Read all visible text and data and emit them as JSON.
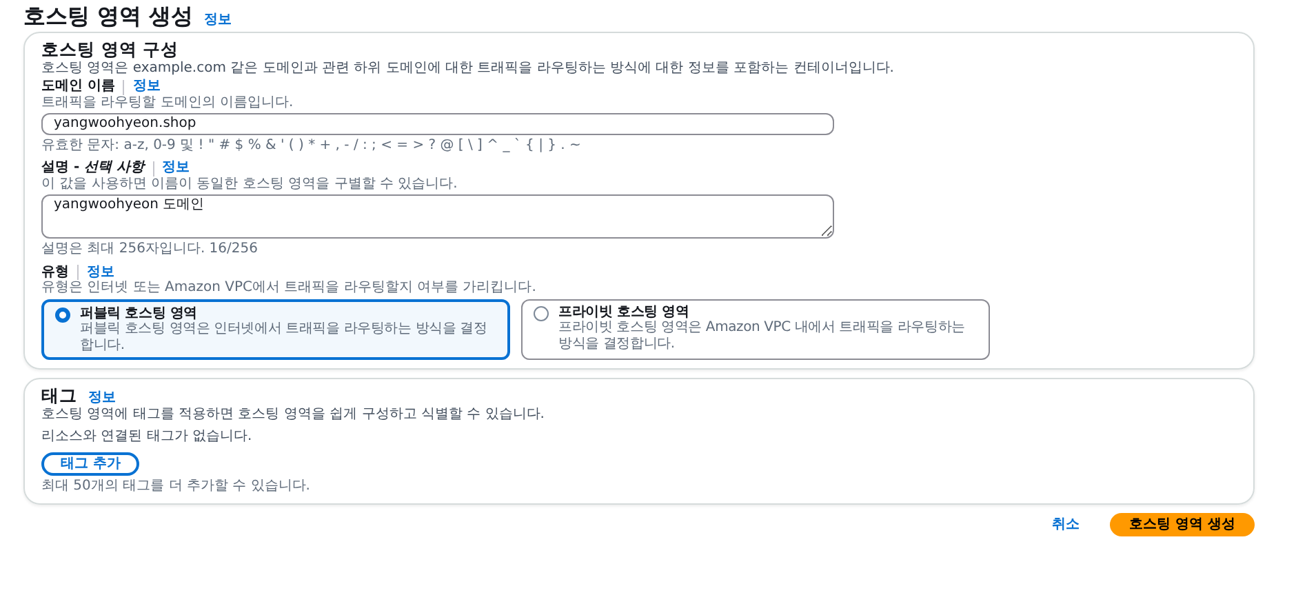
{
  "page": {
    "title": "호스팅 영역 생성",
    "info": "정보"
  },
  "config": {
    "heading": "호스팅 영역 구성",
    "description": "호스팅 영역은 example.com 같은 도메인과 관련 하위 도메인에 대한 트래픽을 라우팅하는 방식에 대한 정보를 포함하는 컨테이너입니다.",
    "fields": [
      {
        "kind": "input",
        "label": "도메인 이름",
        "info": "정보",
        "hint": "트래픽을 라우팅할 도메인의 이름입니다.",
        "value": "yangwoohyeon.shop",
        "note": "유효한 문자: a-z, 0-9 및 ! \" # $ % & ' ( ) * + , - / : ; < = > ? @ [ \\ ] ^ _ ` { | } . ~"
      },
      {
        "kind": "textarea",
        "label": "설명 - *선택 사항*",
        "info": "정보",
        "hint": "이 값을 사용하면 이름이 동일한 호스팅 영역을 구별할 수 있습니다.",
        "value": "yangwoohyeon 도메인",
        "note": "설명은 최대 256자입니다. 16/256"
      },
      {
        "kind": "radio",
        "label": "유형",
        "info": "정보",
        "hint": "유형은 인터넷 또는 Amazon VPC에서 트래픽을 라우팅할지 여부를 가리킵니다.",
        "options": [
          {
            "title": "퍼블릭 호스팅 영역",
            "text": "퍼블릭 호스팅 영역은 인터넷에서 트래픽을 라우팅하는 방식을 결정합니다.",
            "selected": true
          },
          {
            "title": "프라이빗 호스팅 영역",
            "text": "프라이빗 호스팅 영역은 Amazon VPC 내에서 트래픽을 라우팅하는 방식을 결정합니다.",
            "selected": false
          }
        ]
      }
    ]
  },
  "tags": {
    "heading": "태그",
    "info": "정보",
    "description": "호스팅 영역에 태그를 적용하면 호스팅 영역을 쉽게 구성하고 식별할 수 있습니다.",
    "empty": "리소스와 연결된 태그가 없습니다.",
    "button": "태그 추가",
    "limit": "최대 50개의 태그를 더 추가할 수 있습니다."
  },
  "footer": {
    "cancel": "취소",
    "submit": "호스팅 영역 생성"
  }
}
